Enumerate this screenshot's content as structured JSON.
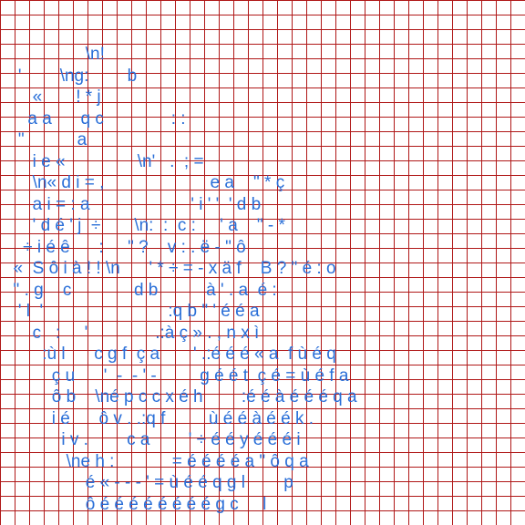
{
  "art": {
    "lines": [
      "                 \\n!",
      "   '        \\ng:        b",
      "      «       ! * j",
      "     a a      q c              : :",
      "   \"           a",
      "      i e «               \\n'   .  ; =",
      "      \\n« d i = ,                      e a    \" * ç",
      "      a i = : a                     ' i ' '  ' d b",
      "      ' d é ' j  ÷       \\n:  :  c :     ' a    \" - *",
      "    ÷ i é ê      :     \" ?    v : . ë - \" ô",
      "  «  S ô i à ! ! \\n      ' * ÷ = - x ä f    B ? \" é : o",
      "  \" . g    c             d b          à ' . a  é :",
      "   ' l  '                          :q b \" ' é é a",
      "      c   :     '              .:à ç » . , n x ì",
      "        :ù l      c g f  ç a       ' .:é é é « a  f ù é q",
      "          ç u      '  -  - ' -         g é é t  ç é = ù é f a",
      "          ô b    \\né p c c x é h        :é é à é é é q a",
      "          i é      ô v . .:q f         ù é é à é é k .",
      "            i v .        c a        ' ÷ é é y é é é i",
      "             \\ne h :            = é é é é a \" ô q a",
      "                 é « - - - ' = ù é é q g l        p",
      "                 ô é é é é é é é é g c     l"
    ]
  },
  "colors": {
    "grid_line": "#b01818",
    "text": "#2a6fd8",
    "background": "#ffffff"
  }
}
